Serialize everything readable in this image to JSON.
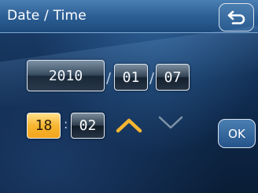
{
  "header": {
    "title": "Date / Time",
    "back_icon": "return-arrow-icon"
  },
  "date": {
    "year": "2010",
    "month": "01",
    "day": "07",
    "separator": "/"
  },
  "time": {
    "hour": "18",
    "minute": "02",
    "separator": ":",
    "selected_field": "hour"
  },
  "controls": {
    "up_icon": "chevron-up-icon",
    "down_icon": "chevron-down-icon",
    "ok_label": "OK"
  },
  "colors": {
    "accent": "#f7b531",
    "title_bar": "#2d5f95",
    "background": "#0f2a4d"
  }
}
